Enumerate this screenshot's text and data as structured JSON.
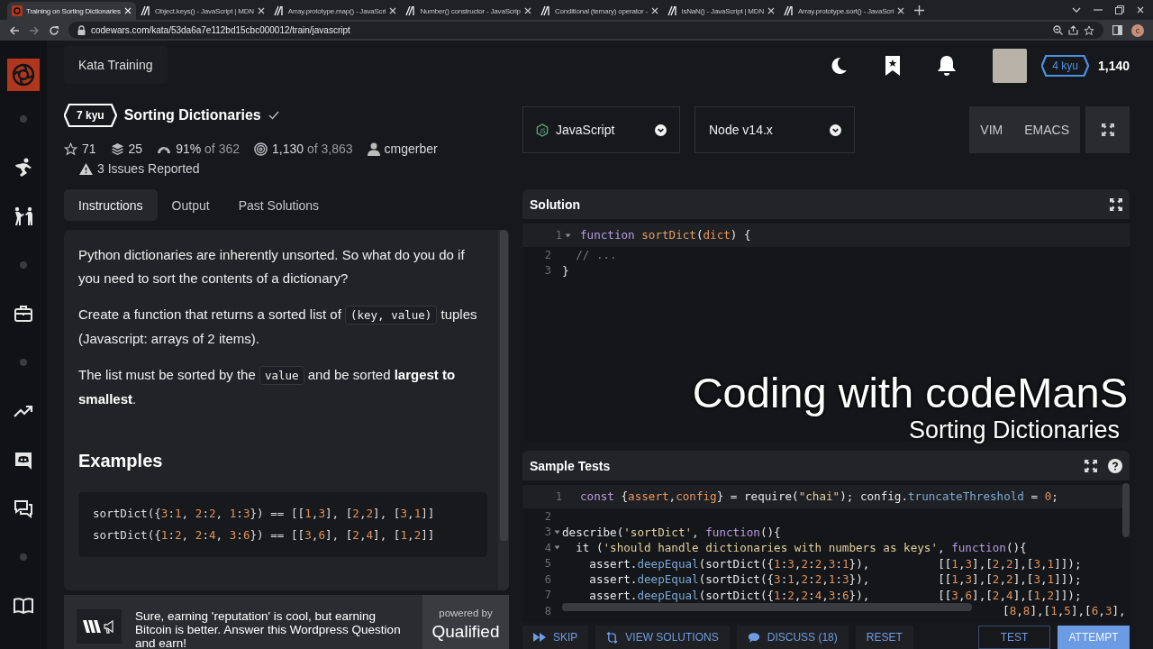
{
  "browser": {
    "tabs": [
      {
        "title": "Training on Sorting Dictionaries",
        "kind": "codewars",
        "selected": true
      },
      {
        "title": "Object.keys() - JavaScript | MDN",
        "kind": "mdn",
        "selected": false
      },
      {
        "title": "Array.prototype.map() - JavaScri",
        "kind": "mdn",
        "selected": false
      },
      {
        "title": "Number() constructor - JavaScrip",
        "kind": "mdn",
        "selected": false
      },
      {
        "title": "Conditional (ternary) operator -",
        "kind": "mdn",
        "selected": false
      },
      {
        "title": "isNaN() - JavaScript | MDN",
        "kind": "mdn",
        "selected": false
      },
      {
        "title": "Array.prototype.sort() - JavaScri",
        "kind": "mdn",
        "selected": false
      }
    ],
    "url": "codewars.com/kata/53da6a7e112bd15cbc000012/train/javascript",
    "profile_initial": "c"
  },
  "header": {
    "section": "Kata Training",
    "rank": "4 kyu",
    "honor": "1,140"
  },
  "kata": {
    "rank": "7 kyu",
    "title": "Sorting Dictionaries",
    "completed": true,
    "stats": [
      {
        "kind": "stars",
        "value": "71"
      },
      {
        "kind": "collections",
        "value": "25"
      },
      {
        "kind": "satisfaction",
        "value": "91%",
        "detail": "of 362"
      },
      {
        "kind": "completions",
        "value": "1,130",
        "detail": "of 3,863"
      },
      {
        "kind": "author",
        "value": "cmgerber"
      }
    ],
    "issues": "3 Issues Reported"
  },
  "tabs": [
    {
      "label": "Instructions",
      "selected": true
    },
    {
      "label": "Output",
      "selected": false
    },
    {
      "label": "Past Solutions",
      "selected": false
    }
  ],
  "description": {
    "paragraphs": [
      [
        {
          "kind": "text",
          "text": "Python dictionaries are inherently unsorted. So what do you do if you need to sort the contents of a dictionary?"
        }
      ],
      [
        {
          "kind": "text",
          "text": "Create a function that returns a sorted list of "
        },
        {
          "kind": "code",
          "text": "(key, value)"
        },
        {
          "kind": "text",
          "text": " tuples (Javascript: arrays of 2 items)."
        }
      ],
      [
        {
          "kind": "text",
          "text": "The list must be sorted by the "
        },
        {
          "kind": "code",
          "text": "value"
        },
        {
          "kind": "text",
          "text": " and be sorted **largest to smallest**."
        }
      ]
    ],
    "heading": "Examples",
    "example_lines": [
      "sortDict({3:1, 2:2, 1:3}) == [[1,3], [2,2], [3,1]]",
      "sortDict({1:2, 2:4, 3:6}) == [[3,6], [2,4], [1,2]]"
    ]
  },
  "ad": {
    "text": "Sure, earning 'reputation' is cool, but earning Bitcoin is better. Answer this Wordpress Question and earn!",
    "powered_by": "powered by",
    "brand": "Qualified"
  },
  "editor": {
    "language": "JavaScript",
    "version": "Node v14.x",
    "modes": [
      "VIM",
      "EMACS"
    ]
  },
  "solution": {
    "title": "Solution",
    "lines": [
      {
        "num": "1",
        "fold": true,
        "active": true,
        "tokens": [
          {
            "kind": "keyword",
            "text": "function"
          },
          {
            "kind": "function",
            "text": " sortDict"
          },
          {
            "kind": "plain",
            "text": "("
          },
          {
            "kind": "variable",
            "text": "dict"
          },
          {
            "kind": "plain",
            "text": ") {"
          }
        ]
      },
      {
        "num": "2",
        "fold": false,
        "active": false,
        "tokens": [
          {
            "kind": "comment",
            "text": "  // ..."
          }
        ]
      },
      {
        "num": "3",
        "fold": false,
        "active": false,
        "tokens": [
          {
            "kind": "plain",
            "text": "}"
          }
        ]
      }
    ]
  },
  "overlay": {
    "title": "Coding with codeManS",
    "subtitle": "Sorting Dictionaries"
  },
  "sample_tests": {
    "title": "Sample Tests",
    "lines": [
      {
        "num": "1",
        "fold": false,
        "active": true,
        "tokens": [
          {
            "kind": "keyword",
            "text": "const"
          },
          {
            "kind": "plain",
            "text": " {"
          },
          {
            "kind": "variable",
            "text": "assert"
          },
          {
            "kind": "plain",
            "text": ","
          },
          {
            "kind": "variable",
            "text": "config"
          },
          {
            "kind": "plain",
            "text": "} = require("
          },
          {
            "kind": "string",
            "text": "\"chai\""
          },
          {
            "kind": "plain",
            "text": "); config."
          },
          {
            "kind": "method",
            "text": "truncateThreshold"
          },
          {
            "kind": "plain",
            "text": " = 0;"
          }
        ]
      },
      {
        "num": "2",
        "fold": false,
        "active": false
      },
      {
        "num": "3",
        "fold": true,
        "active": false,
        "tokens": [
          {
            "kind": "plain",
            "text": "describe("
          },
          {
            "kind": "string",
            "text": "'sortDict'"
          },
          {
            "kind": "plain",
            "text": ", "
          },
          {
            "kind": "keyword",
            "text": "function"
          },
          {
            "kind": "plain",
            "text": "(){"
          }
        ]
      },
      {
        "num": "4",
        "fold": true,
        "active": false,
        "tokens": [
          {
            "kind": "plain",
            "text": "  it ("
          },
          {
            "kind": "string",
            "text": "'should handle dictionaries with numbers as keys'"
          },
          {
            "kind": "plain",
            "text": ", "
          },
          {
            "kind": "keyword",
            "text": "function"
          },
          {
            "kind": "plain",
            "text": "(){"
          }
        ]
      },
      {
        "num": "5",
        "fold": false,
        "active": false,
        "tokens": [
          {
            "kind": "plain",
            "text": "    assert."
          },
          {
            "kind": "method",
            "text": "deepEqual"
          },
          {
            "kind": "plain",
            "text": "(sortDict({1:3,2:2,3:1}),          [[1,3],[2,2],[3,1]]);"
          }
        ]
      },
      {
        "num": "6",
        "fold": false,
        "active": false,
        "tokens": [
          {
            "kind": "plain",
            "text": "    assert."
          },
          {
            "kind": "method",
            "text": "deepEqual"
          },
          {
            "kind": "plain",
            "text": "(sortDict({3:1,2:2,1:3}),          [[1,3],[2,2],[3,1]]);"
          }
        ]
      },
      {
        "num": "7",
        "fold": false,
        "active": false,
        "tokens": [
          {
            "kind": "plain",
            "text": "    assert."
          },
          {
            "kind": "method",
            "text": "deepEqual"
          },
          {
            "kind": "plain",
            "text": "(sortDict({1:2,2:4,3:6}),          [[3,6],[2,4],[1,2]]);"
          }
        ]
      },
      {
        "num": "8",
        "fold": false,
        "active": false,
        "kind": "clipped",
        "tokens": [
          {
            "kind": "plain",
            "text": "[8,8],[1,5],[6,3],"
          }
        ]
      }
    ]
  },
  "actions": [
    {
      "kind": "skip",
      "label": "SKIP"
    },
    {
      "kind": "solutions",
      "label": "VIEW SOLUTIONS"
    },
    {
      "kind": "discuss",
      "label": "DISCUSS (18)"
    },
    {
      "kind": "reset",
      "label": "RESET"
    },
    {
      "kind": "test",
      "label": "TEST"
    },
    {
      "kind": "attempt",
      "label": "ATTEMPT"
    }
  ]
}
